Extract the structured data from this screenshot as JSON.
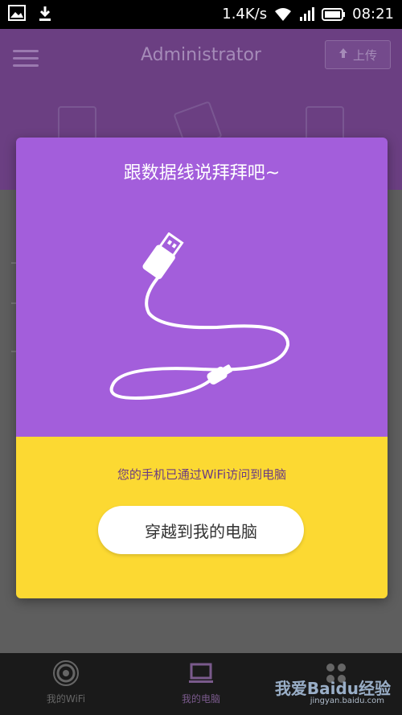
{
  "status_bar": {
    "net_speed": "1.4K/s",
    "time": "08:21",
    "icons": [
      "image-icon",
      "download-icon",
      "wifi-icon",
      "signal-icon",
      "battery-icon"
    ]
  },
  "app_bar": {
    "title": "Administrator",
    "upload_label": "上传",
    "icons": [
      "clipboard-icon",
      "documents-icon",
      "phone-sync-icon"
    ]
  },
  "dialog": {
    "title": "跟数据线说拜拜吧~",
    "message": "您的手机已通过WiFi访问到电脑",
    "button_label": "穿越到我的电脑",
    "illustration": "usb-cable-icon"
  },
  "bottom_nav": {
    "items": [
      {
        "label": "我的WiFi",
        "icon": "wifi-broadcast-icon",
        "active": false
      },
      {
        "label": "我的电脑",
        "icon": "laptop-icon",
        "active": true
      },
      {
        "label": "",
        "icon": "more-icon",
        "active": false
      }
    ]
  },
  "watermark": {
    "text": "我爱Baidu经验",
    "sub": "jingyan.baidu.com"
  },
  "colors": {
    "dialog_purple": "#a35edb",
    "dialog_yellow": "#fcd932",
    "header_purple": "#6b3f82"
  }
}
